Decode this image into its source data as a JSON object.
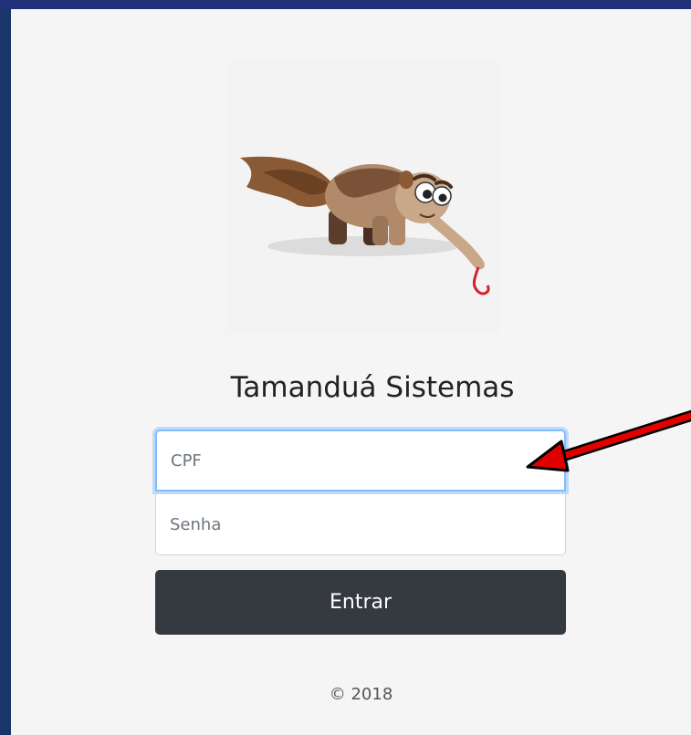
{
  "app": {
    "title": "Tamanduá Sistemas",
    "logo": "anteater-logo"
  },
  "form": {
    "cpf_placeholder": "CPF",
    "cpf_value": "",
    "senha_placeholder": "Senha",
    "senha_value": "",
    "submit_label": "Entrar"
  },
  "footer": {
    "copyright": "© 2018"
  },
  "colors": {
    "page_frame": "#1a3569",
    "panel_bg": "#f5f5f5",
    "button_bg": "#343a40",
    "focus_border": "#80bdff",
    "annotation_arrow": "#ff0000"
  }
}
